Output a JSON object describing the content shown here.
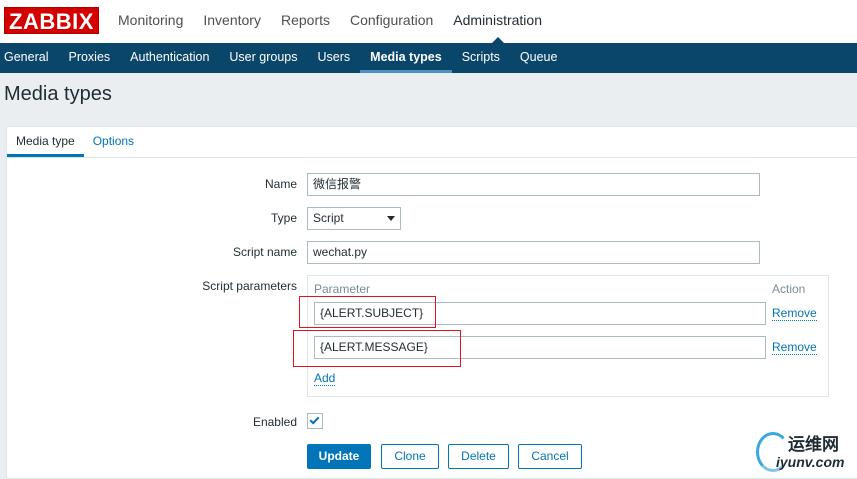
{
  "logo": "ZABBIX",
  "top_menu": [
    "Monitoring",
    "Inventory",
    "Reports",
    "Configuration",
    "Administration"
  ],
  "top_menu_active": "Administration",
  "sub_menu": [
    "General",
    "Proxies",
    "Authentication",
    "User groups",
    "Users",
    "Media types",
    "Scripts",
    "Queue"
  ],
  "sub_menu_active": "Media types",
  "page_title": "Media types",
  "tabs": [
    "Media type",
    "Options"
  ],
  "form": {
    "name_label": "Name",
    "name_value": "微信报警",
    "type_label": "Type",
    "type_value": "Script",
    "script_name_label": "Script name",
    "script_name_value": "wechat.py",
    "script_params_label": "Script parameters",
    "params_header_param": "Parameter",
    "params_header_action": "Action",
    "params": [
      "{ALERT.SUBJECT}",
      "{ALERT.MESSAGE}"
    ],
    "remove_label": "Remove",
    "add_label": "Add",
    "enabled_label": "Enabled",
    "enabled": true
  },
  "buttons": {
    "update": "Update",
    "clone": "Clone",
    "delete": "Delete",
    "cancel": "Cancel"
  },
  "watermark": {
    "cn": "运维网",
    "url": "iyunv.com"
  },
  "colors": {
    "accent": "#0275b8",
    "nav": "#0a466a",
    "logo": "#d40000",
    "highlight": "#e0141e"
  }
}
